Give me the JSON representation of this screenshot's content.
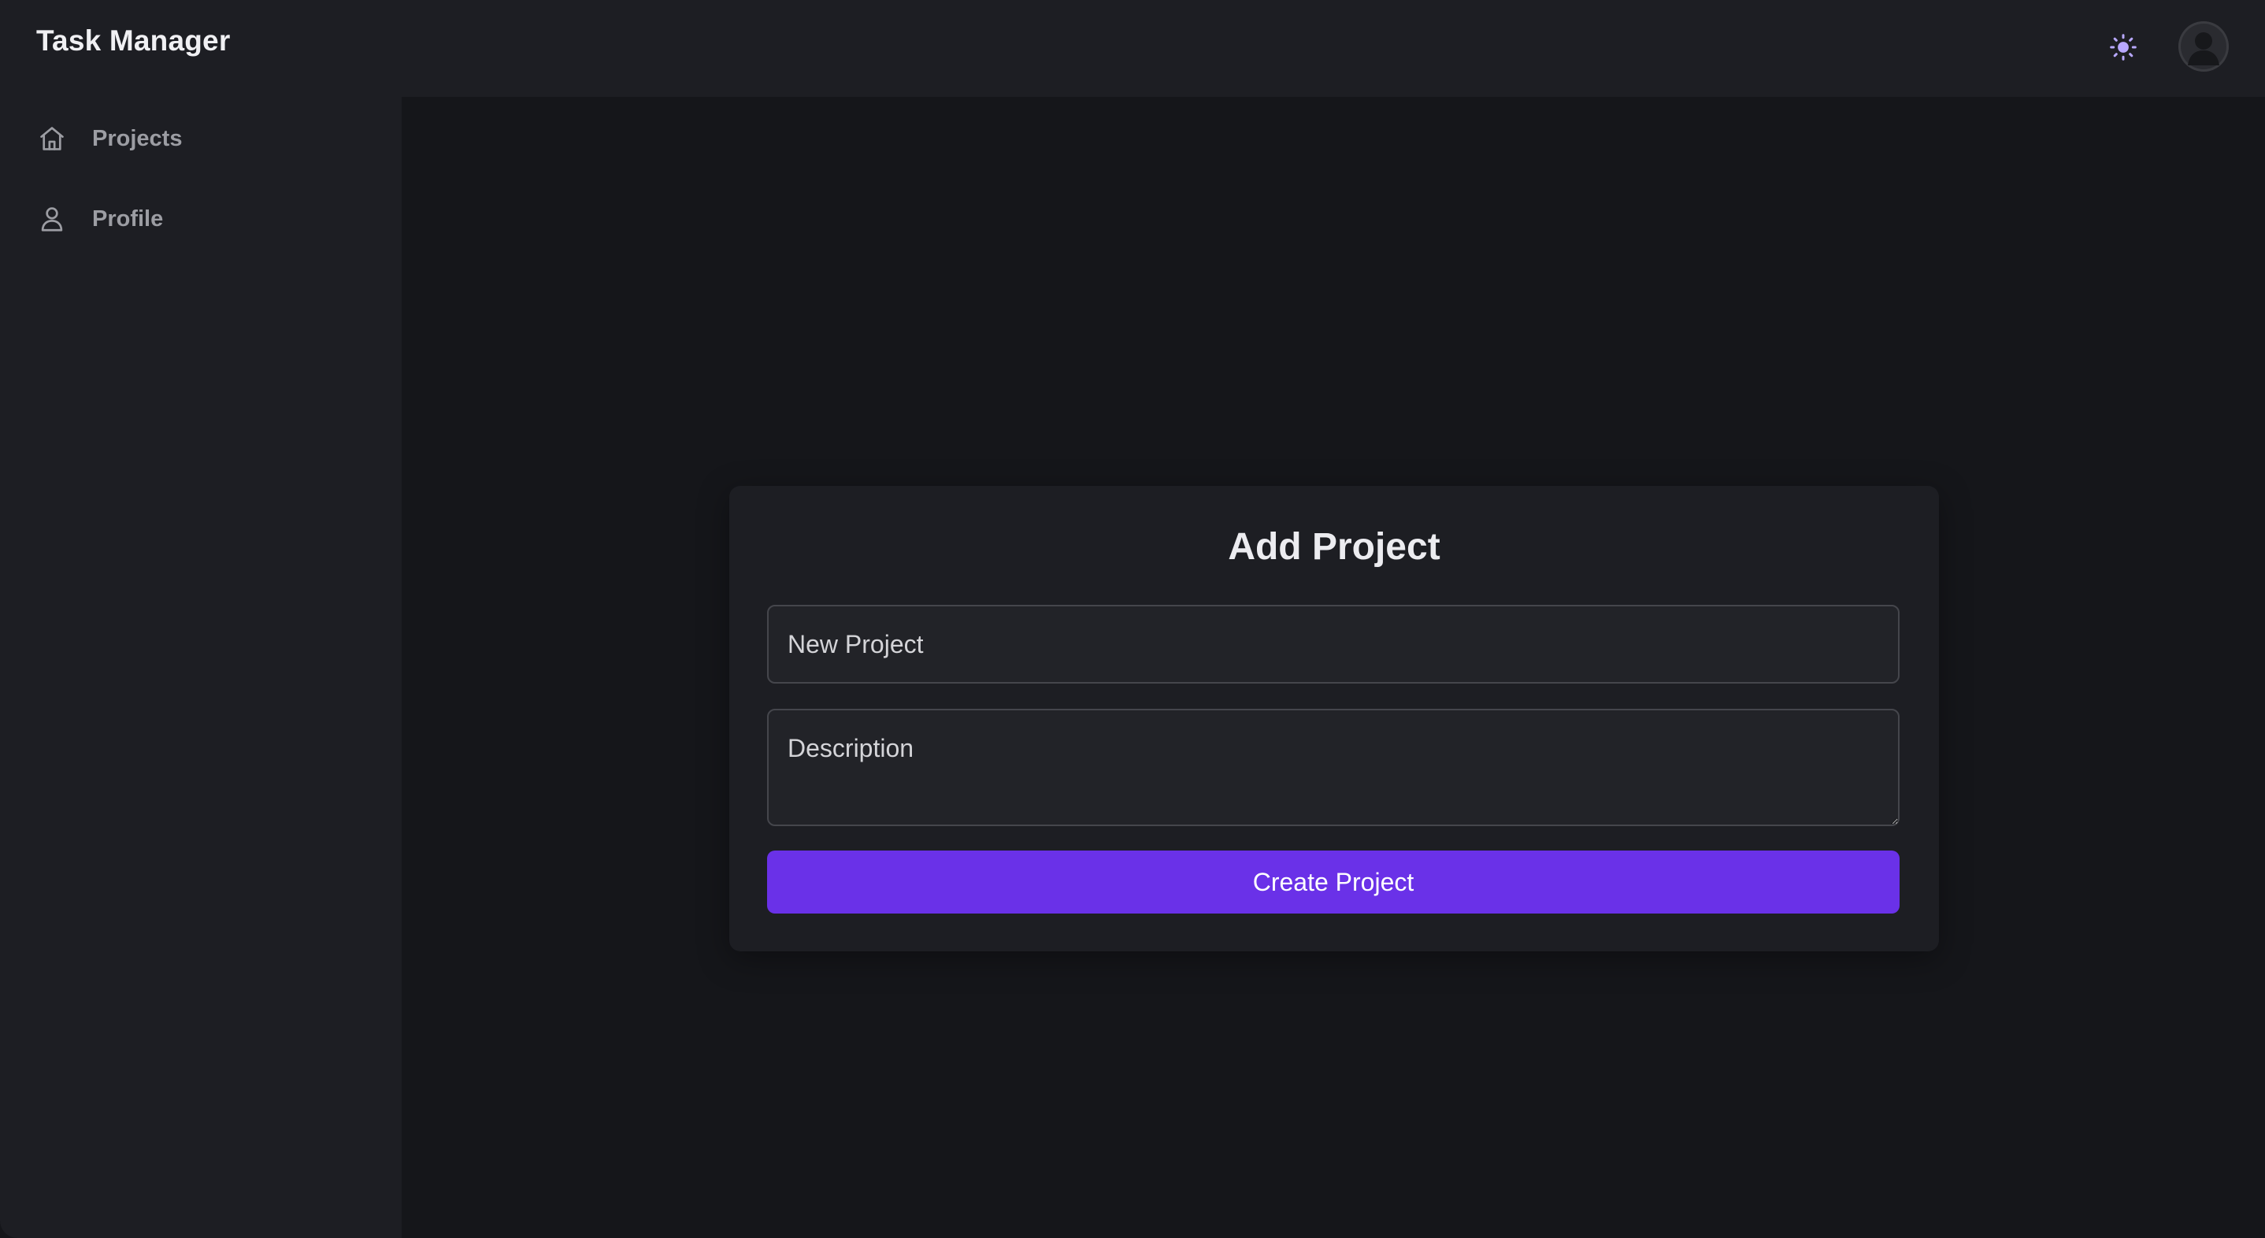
{
  "header": {
    "title": "Task Manager",
    "theme_icon": "sun-icon",
    "avatar_icon": "user-avatar"
  },
  "sidebar": {
    "items": [
      {
        "label": "Projects",
        "icon": "home-icon"
      },
      {
        "label": "Profile",
        "icon": "user-icon"
      }
    ]
  },
  "form": {
    "title": "Add Project",
    "name_placeholder": "New Project",
    "description_placeholder": "Description",
    "submit_label": "Create Project"
  },
  "colors": {
    "accent": "#6a31e8",
    "theme_icon": "#b8a8ff",
    "background": "#15161a",
    "surface": "#1d1e23"
  }
}
